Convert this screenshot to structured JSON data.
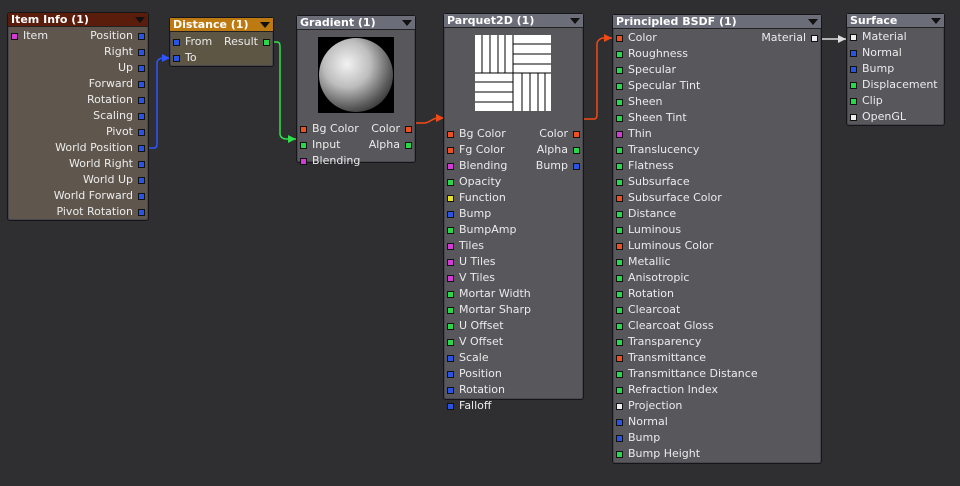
{
  "colors": {
    "background": "#2f2f31",
    "socket_blue": "#2a54e6",
    "socket_green": "#27d84a",
    "socket_orange": "#ee5022",
    "socket_magenta": "#d23bd6",
    "socket_yellow": "#e8e024",
    "socket_white": "#eeeeee",
    "wire_blue": "#2f55ff",
    "wire_green": "#2fe04a",
    "wire_orange": "#f04a16",
    "wire_white": "#dddddd"
  },
  "nodes": {
    "item_info": {
      "title": "Item Info (1)",
      "inputs": [
        {
          "label": "Item",
          "socket": "magenta"
        }
      ],
      "outputs": [
        {
          "label": "Position",
          "socket": "blue"
        },
        {
          "label": "Right",
          "socket": "blue"
        },
        {
          "label": "Up",
          "socket": "blue"
        },
        {
          "label": "Forward",
          "socket": "blue"
        },
        {
          "label": "Rotation",
          "socket": "blue"
        },
        {
          "label": "Scaling",
          "socket": "blue"
        },
        {
          "label": "Pivot",
          "socket": "blue"
        },
        {
          "label": "World Position",
          "socket": "blue"
        },
        {
          "label": "World Right",
          "socket": "blue"
        },
        {
          "label": "World Up",
          "socket": "blue"
        },
        {
          "label": "World Forward",
          "socket": "blue"
        },
        {
          "label": "Pivot Rotation",
          "socket": "blue"
        }
      ]
    },
    "distance": {
      "title": "Distance (1)",
      "inputs": [
        {
          "label": "From",
          "socket": "blue"
        },
        {
          "label": "To",
          "socket": "blue"
        }
      ],
      "outputs": [
        {
          "label": "Result",
          "socket": "green"
        }
      ]
    },
    "gradient": {
      "title": "Gradient (1)",
      "rows": [
        {
          "left": "Bg Color",
          "left_socket": "orange",
          "right": "Color",
          "right_socket": "orange"
        },
        {
          "left": "Input",
          "left_socket": "green",
          "right": "Alpha",
          "right_socket": "green"
        },
        {
          "left": "Blending",
          "left_socket": "magenta",
          "right": "",
          "right_socket": ""
        }
      ]
    },
    "parquet": {
      "title": "Parquet2D (1)",
      "rows": [
        {
          "left": "Bg Color",
          "left_socket": "orange",
          "right": "Color",
          "right_socket": "orange"
        },
        {
          "left": "Fg Color",
          "left_socket": "orange",
          "right": "Alpha",
          "right_socket": "green"
        },
        {
          "left": "Blending",
          "left_socket": "magenta",
          "right": "Bump",
          "right_socket": "blue"
        },
        {
          "left": "Opacity",
          "left_socket": "green",
          "right": "",
          "right_socket": ""
        },
        {
          "left": "Function",
          "left_socket": "yellow",
          "right": "",
          "right_socket": ""
        },
        {
          "left": "Bump",
          "left_socket": "blue",
          "right": "",
          "right_socket": ""
        },
        {
          "left": "BumpAmp",
          "left_socket": "green",
          "right": "",
          "right_socket": ""
        },
        {
          "left": "Tiles",
          "left_socket": "magenta",
          "right": "",
          "right_socket": ""
        },
        {
          "left": "U Tiles",
          "left_socket": "magenta",
          "right": "",
          "right_socket": ""
        },
        {
          "left": "V Tiles",
          "left_socket": "magenta",
          "right": "",
          "right_socket": ""
        },
        {
          "left": "Mortar Width",
          "left_socket": "green",
          "right": "",
          "right_socket": ""
        },
        {
          "left": "Mortar Sharp",
          "left_socket": "green",
          "right": "",
          "right_socket": ""
        },
        {
          "left": "U Offset",
          "left_socket": "green",
          "right": "",
          "right_socket": ""
        },
        {
          "left": "V Offset",
          "left_socket": "green",
          "right": "",
          "right_socket": ""
        },
        {
          "left": "Scale",
          "left_socket": "blue",
          "right": "",
          "right_socket": ""
        },
        {
          "left": "Position",
          "left_socket": "blue",
          "right": "",
          "right_socket": ""
        },
        {
          "left": "Rotation",
          "left_socket": "blue",
          "right": "",
          "right_socket": ""
        },
        {
          "left": "Falloff",
          "left_socket": "blue",
          "right": "",
          "right_socket": ""
        }
      ]
    },
    "bsdf": {
      "title": "Principled BSDF (1)",
      "rows": [
        {
          "left": "Color",
          "left_socket": "orange",
          "right": "Material",
          "right_socket": "white"
        },
        {
          "left": "Roughness",
          "left_socket": "green",
          "right": "",
          "right_socket": ""
        },
        {
          "left": "Specular",
          "left_socket": "green",
          "right": "",
          "right_socket": ""
        },
        {
          "left": "Specular Tint",
          "left_socket": "green",
          "right": "",
          "right_socket": ""
        },
        {
          "left": "Sheen",
          "left_socket": "green",
          "right": "",
          "right_socket": ""
        },
        {
          "left": "Sheen Tint",
          "left_socket": "green",
          "right": "",
          "right_socket": ""
        },
        {
          "left": "Thin",
          "left_socket": "magenta",
          "right": "",
          "right_socket": ""
        },
        {
          "left": "Translucency",
          "left_socket": "green",
          "right": "",
          "right_socket": ""
        },
        {
          "left": "Flatness",
          "left_socket": "green",
          "right": "",
          "right_socket": ""
        },
        {
          "left": "Subsurface",
          "left_socket": "green",
          "right": "",
          "right_socket": ""
        },
        {
          "left": "Subsurface Color",
          "left_socket": "orange",
          "right": "",
          "right_socket": ""
        },
        {
          "left": "Distance",
          "left_socket": "green",
          "right": "",
          "right_socket": ""
        },
        {
          "left": "Luminous",
          "left_socket": "green",
          "right": "",
          "right_socket": ""
        },
        {
          "left": "Luminous Color",
          "left_socket": "orange",
          "right": "",
          "right_socket": ""
        },
        {
          "left": "Metallic",
          "left_socket": "green",
          "right": "",
          "right_socket": ""
        },
        {
          "left": "Anisotropic",
          "left_socket": "green",
          "right": "",
          "right_socket": ""
        },
        {
          "left": "Rotation",
          "left_socket": "green",
          "right": "",
          "right_socket": ""
        },
        {
          "left": "Clearcoat",
          "left_socket": "green",
          "right": "",
          "right_socket": ""
        },
        {
          "left": "Clearcoat Gloss",
          "left_socket": "green",
          "right": "",
          "right_socket": ""
        },
        {
          "left": "Transparency",
          "left_socket": "green",
          "right": "",
          "right_socket": ""
        },
        {
          "left": "Transmittance",
          "left_socket": "orange",
          "right": "",
          "right_socket": ""
        },
        {
          "left": "Transmittance Distance",
          "left_socket": "green",
          "right": "",
          "right_socket": ""
        },
        {
          "left": "Refraction Index",
          "left_socket": "green",
          "right": "",
          "right_socket": ""
        },
        {
          "left": "Projection",
          "left_socket": "white",
          "right": "",
          "right_socket": ""
        },
        {
          "left": "Normal",
          "left_socket": "blue",
          "right": "",
          "right_socket": ""
        },
        {
          "left": "Bump",
          "left_socket": "blue",
          "right": "",
          "right_socket": ""
        },
        {
          "left": "Bump Height",
          "left_socket": "green",
          "right": "",
          "right_socket": ""
        }
      ]
    },
    "surface": {
      "title": "Surface",
      "inputs": [
        {
          "label": "Material",
          "socket": "white"
        },
        {
          "label": "Normal",
          "socket": "blue"
        },
        {
          "label": "Bump",
          "socket": "blue"
        },
        {
          "label": "Displacement",
          "socket": "green"
        },
        {
          "label": "Clip",
          "socket": "green"
        },
        {
          "label": "OpenGL",
          "socket": "white"
        }
      ]
    }
  },
  "connections": [
    {
      "from": "Item Info (1).World Position",
      "to": "Distance (1).From",
      "color": "blue"
    },
    {
      "from": "Distance (1).Result",
      "to": "Gradient (1).Input",
      "color": "green"
    },
    {
      "from": "Gradient (1).Color",
      "to": "Parquet2D (1).Bg Color",
      "color": "orange"
    },
    {
      "from": "Parquet2D (1).Color",
      "to": "Principled BSDF (1).Color",
      "color": "orange"
    },
    {
      "from": "Principled BSDF (1).Material",
      "to": "Surface.Material",
      "color": "white"
    }
  ]
}
